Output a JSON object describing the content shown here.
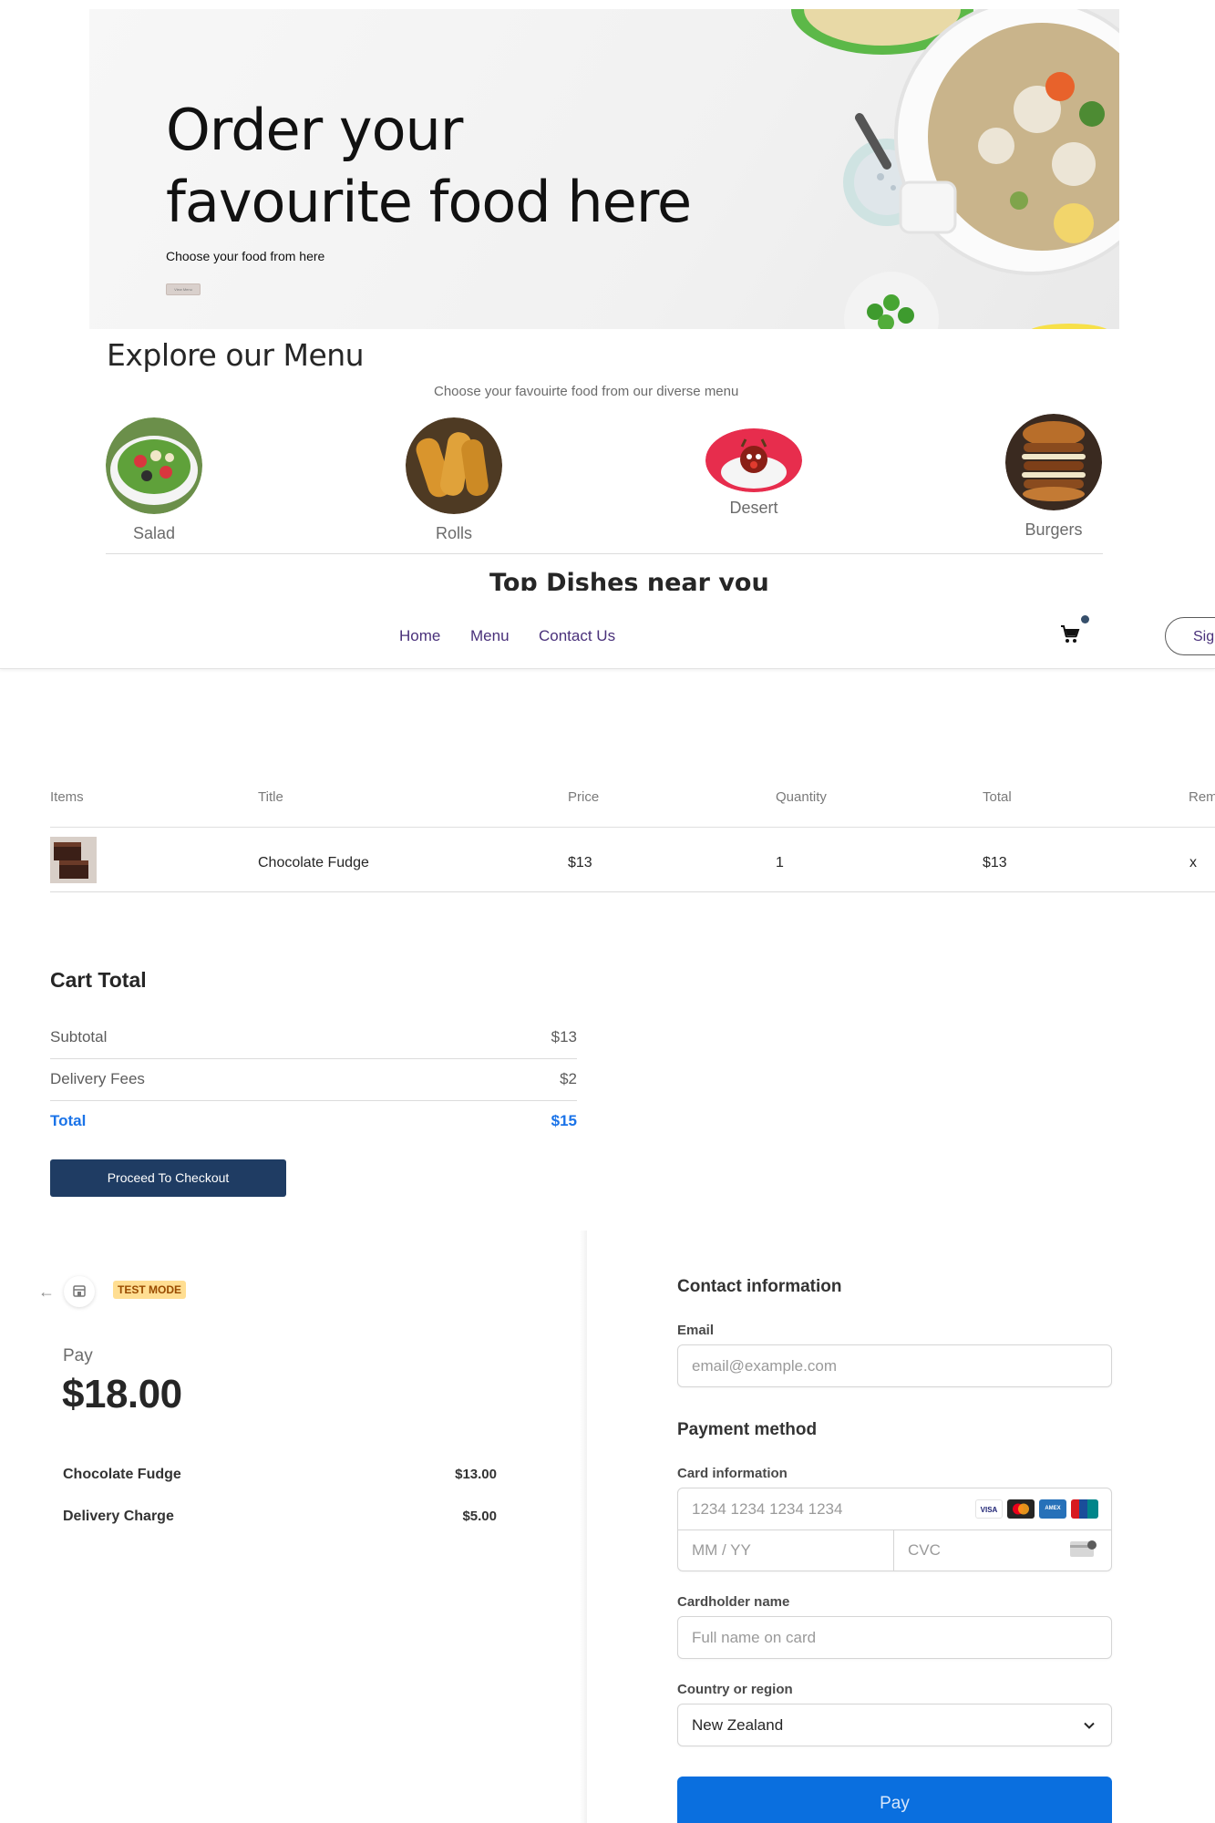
{
  "hero": {
    "title_line1": "Order your",
    "title_line2": "favourite food here",
    "subtitle": "Choose your food from here",
    "button_label": "View Menu"
  },
  "explore": {
    "title": "Explore our Menu",
    "subtitle": "Choose your favouirte food from our diverse menu",
    "items": [
      {
        "label": "Salad"
      },
      {
        "label": "Rolls"
      },
      {
        "label": "Desert"
      },
      {
        "label": "Burgers"
      }
    ],
    "next_section_title": "Top Dishes near you"
  },
  "navbar": {
    "links": [
      "Home",
      "Menu",
      "Contact Us"
    ],
    "signin_label": "Sign in"
  },
  "cart": {
    "headers": [
      "Items",
      "Title",
      "Price",
      "Quantity",
      "Total",
      "Remove"
    ],
    "rows": [
      {
        "title": "Chocolate Fudge",
        "price": "$13",
        "quantity": "1",
        "total": "$13",
        "remove": "x"
      }
    ]
  },
  "cart_total": {
    "title": "Cart Total",
    "subtotal_label": "Subtotal",
    "subtotal_value": "$13",
    "delivery_label": "Delivery Fees",
    "delivery_value": "$2",
    "total_label": "Total",
    "total_value": "$15",
    "checkout_label": "Proceed To Checkout"
  },
  "checkout": {
    "test_mode_badge": "TEST MODE",
    "pay_label": "Pay",
    "pay_amount": "$18.00",
    "line_items": [
      {
        "name": "Chocolate Fudge",
        "amount": "$13.00"
      },
      {
        "name": "Delivery Charge",
        "amount": "$5.00"
      }
    ],
    "contact_heading": "Contact information",
    "email_label": "Email",
    "email_placeholder": "email@example.com",
    "payment_heading": "Payment method",
    "card_label": "Card information",
    "card_number_placeholder": "1234 1234 1234 1234",
    "expiry_placeholder": "MM / YY",
    "cvc_placeholder": "CVC",
    "card_brands": [
      "VISA",
      "Mastercard",
      "AMEX",
      "UnionPay"
    ],
    "cardholder_label": "Cardholder name",
    "cardholder_placeholder": "Full name on card",
    "country_label": "Country or region",
    "country_value": "New Zealand",
    "pay_button": "Pay"
  },
  "colors": {
    "nav_link": "#49307a",
    "checkout_button": "#1f3c63",
    "total_accent": "#1a73e8",
    "pay_button": "#0a6fdf",
    "test_badge_bg": "#ffde92"
  }
}
